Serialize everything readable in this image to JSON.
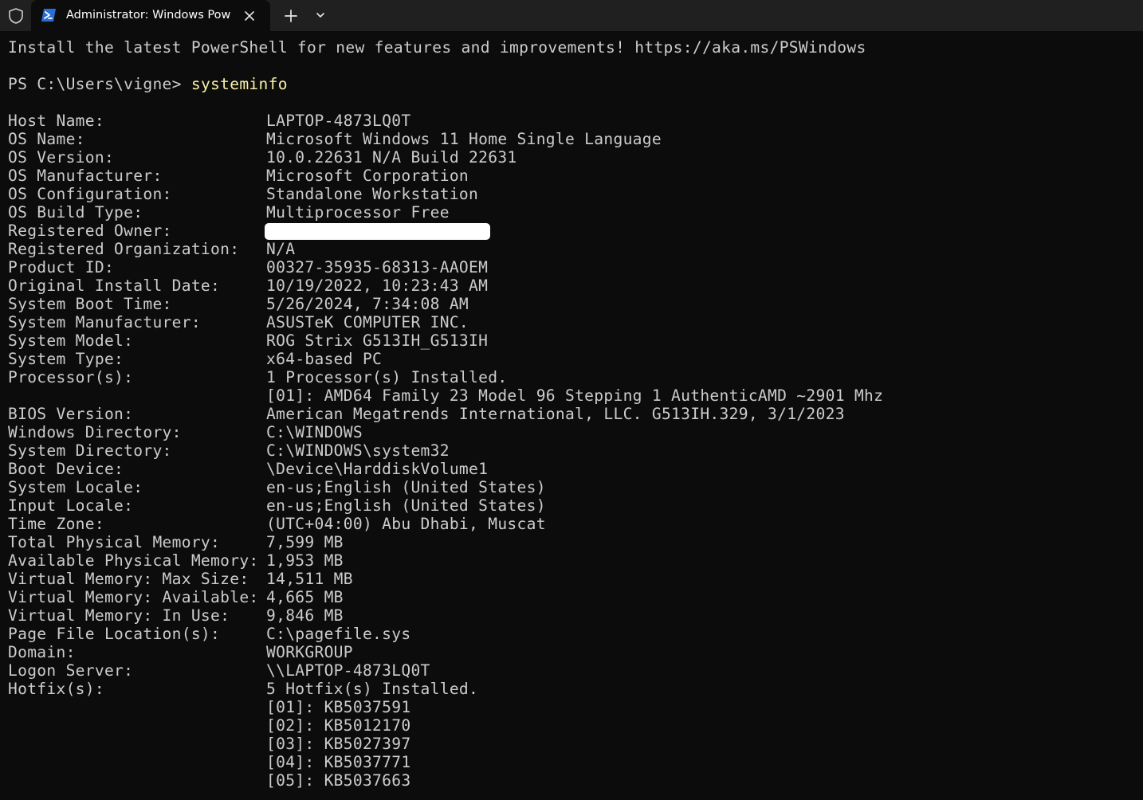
{
  "tabbar": {
    "tab_title": "Administrator: Windows Powe",
    "new_tab_label": "+"
  },
  "banner": "Install the latest PowerShell for new features and improvements! https://aka.ms/PSWindows",
  "prompt": {
    "path": "PS C:\\Users\\vigne> ",
    "command": "systeminfo"
  },
  "sysinfo": [
    {
      "key": "Host Name:",
      "value": "LAPTOP-4873LQ0T"
    },
    {
      "key": "OS Name:",
      "value": "Microsoft Windows 11 Home Single Language"
    },
    {
      "key": "OS Version:",
      "value": "10.0.22631 N/A Build 22631"
    },
    {
      "key": "OS Manufacturer:",
      "value": "Microsoft Corporation"
    },
    {
      "key": "OS Configuration:",
      "value": "Standalone Workstation"
    },
    {
      "key": "OS Build Type:",
      "value": "Multiprocessor Free"
    },
    {
      "key": "Registered Owner:",
      "value": ""
    },
    {
      "key": "Registered Organization:",
      "value": "N/A"
    },
    {
      "key": "Product ID:",
      "value": "00327-35935-68313-AAOEM"
    },
    {
      "key": "Original Install Date:",
      "value": "10/19/2022, 10:23:43 AM"
    },
    {
      "key": "System Boot Time:",
      "value": "5/26/2024, 7:34:08 AM"
    },
    {
      "key": "System Manufacturer:",
      "value": "ASUSTeK COMPUTER INC."
    },
    {
      "key": "System Model:",
      "value": "ROG Strix G513IH_G513IH"
    },
    {
      "key": "System Type:",
      "value": "x64-based PC"
    },
    {
      "key": "Processor(s):",
      "value": "1 Processor(s) Installed."
    },
    {
      "key": "",
      "value": "[01]: AMD64 Family 23 Model 96 Stepping 1 AuthenticAMD ~2901 Mhz"
    },
    {
      "key": "BIOS Version:",
      "value": "American Megatrends International, LLC. G513IH.329, 3/1/2023"
    },
    {
      "key": "Windows Directory:",
      "value": "C:\\WINDOWS"
    },
    {
      "key": "System Directory:",
      "value": "C:\\WINDOWS\\system32"
    },
    {
      "key": "Boot Device:",
      "value": "\\Device\\HarddiskVolume1"
    },
    {
      "key": "System Locale:",
      "value": "en-us;English (United States)"
    },
    {
      "key": "Input Locale:",
      "value": "en-us;English (United States)"
    },
    {
      "key": "Time Zone:",
      "value": "(UTC+04:00) Abu Dhabi, Muscat"
    },
    {
      "key": "Total Physical Memory:",
      "value": "7,599 MB"
    },
    {
      "key": "Available Physical Memory:",
      "value": "1,953 MB"
    },
    {
      "key": "Virtual Memory: Max Size:",
      "value": "14,511 MB"
    },
    {
      "key": "Virtual Memory: Available:",
      "value": "4,665 MB"
    },
    {
      "key": "Virtual Memory: In Use:",
      "value": "9,846 MB"
    },
    {
      "key": "Page File Location(s):",
      "value": "C:\\pagefile.sys"
    },
    {
      "key": "Domain:",
      "value": "WORKGROUP"
    },
    {
      "key": "Logon Server:",
      "value": "\\\\LAPTOP-4873LQ0T"
    },
    {
      "key": "Hotfix(s):",
      "value": "5 Hotfix(s) Installed."
    },
    {
      "key": "",
      "value": "[01]: KB5037591"
    },
    {
      "key": "",
      "value": "[02]: KB5012170"
    },
    {
      "key": "",
      "value": "[03]: KB5027397"
    },
    {
      "key": "",
      "value": "[04]: KB5037771"
    },
    {
      "key": "",
      "value": "[05]: KB5037663"
    }
  ]
}
